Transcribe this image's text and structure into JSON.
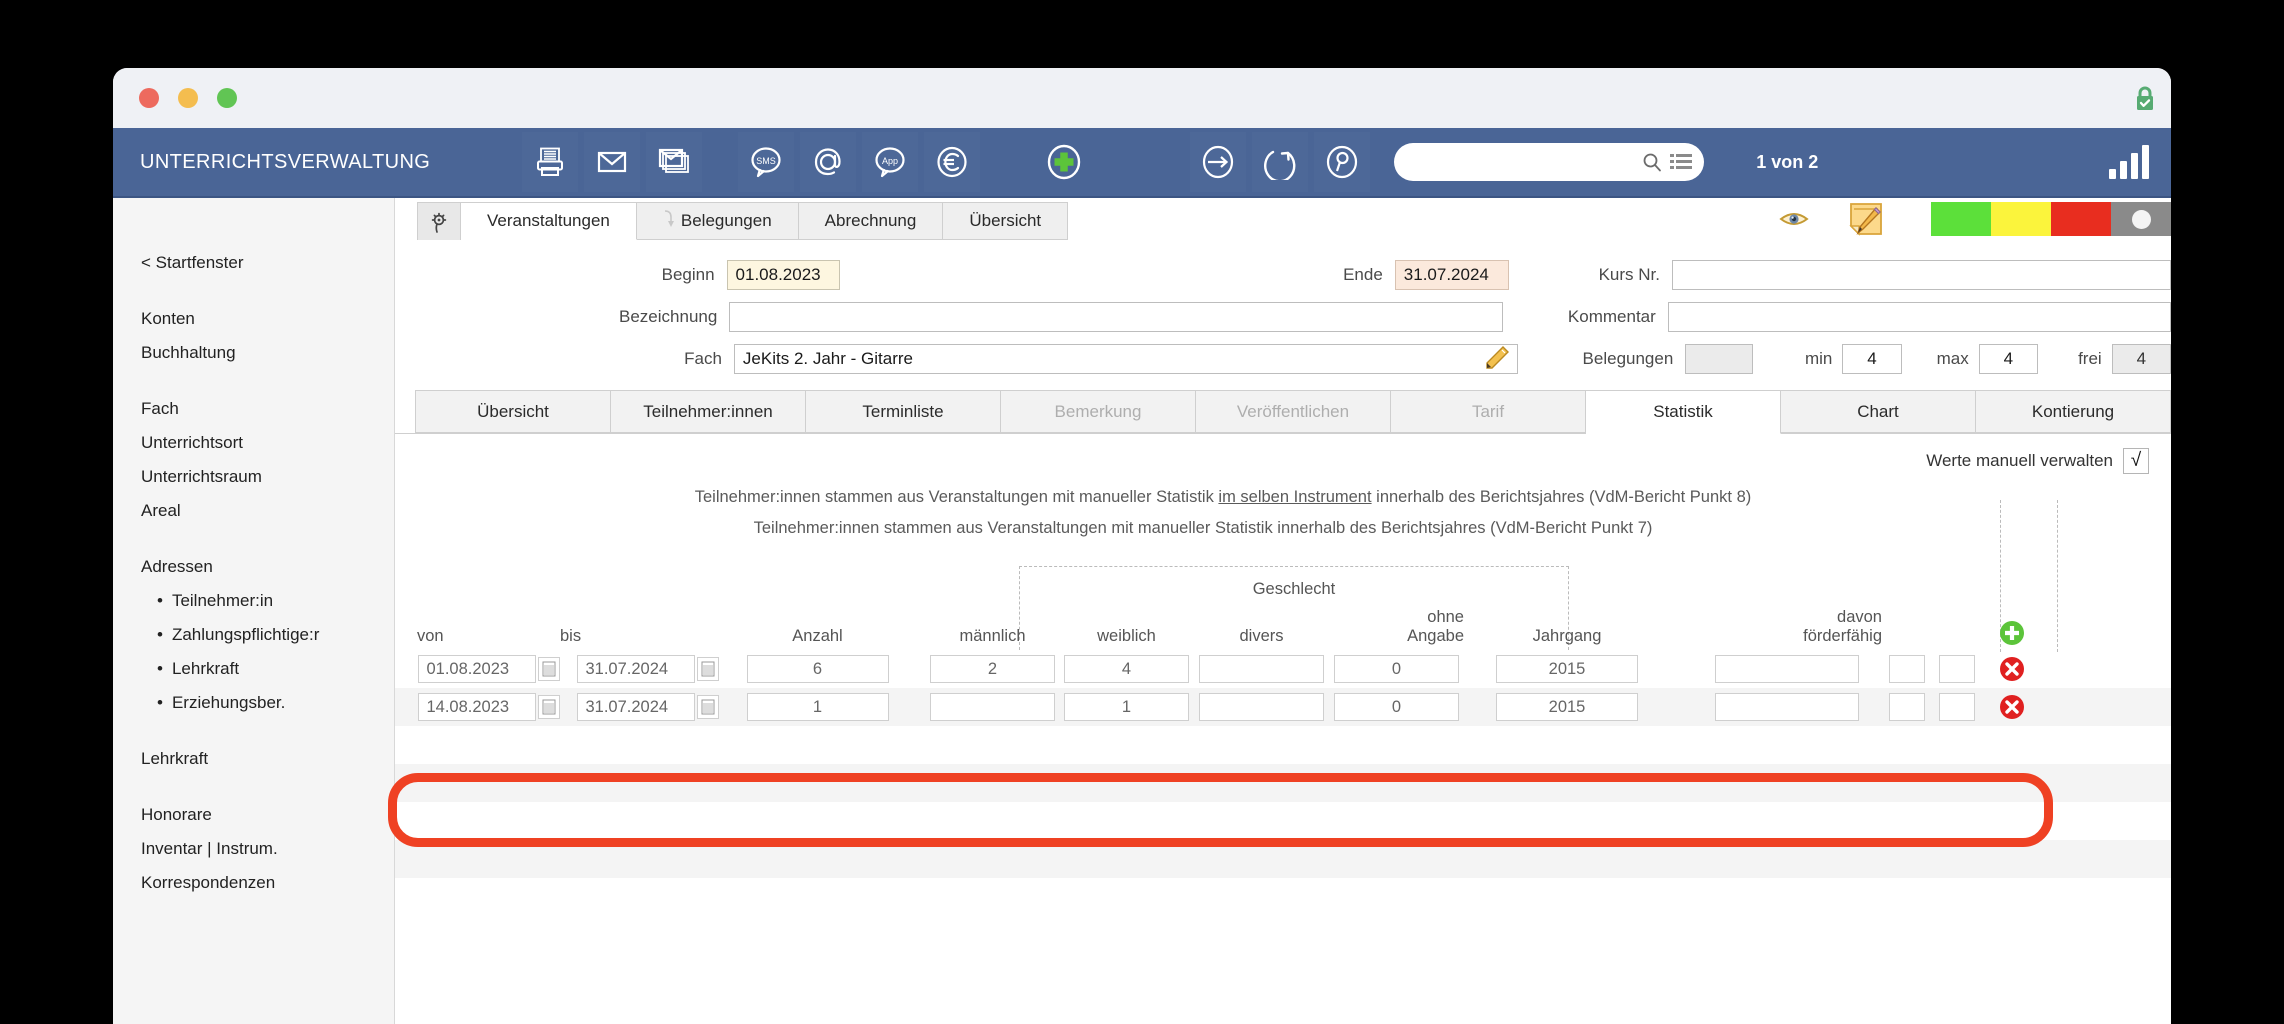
{
  "window": {
    "title": "UNTERRICHTSVERWALTUNG",
    "lock_icon": "lock-secure-icon"
  },
  "toolbar": {
    "icons": [
      {
        "name": "printer-icon",
        "label": "Drucken"
      },
      {
        "name": "mail-icon",
        "label": "E-Mail"
      },
      {
        "name": "mail-stack-icon",
        "label": "Serienmail"
      },
      {
        "name": "sms-bubble-icon",
        "label": "SMS"
      },
      {
        "name": "at-sign-icon",
        "label": "E-Mail Adresse"
      },
      {
        "name": "app-bubble-icon",
        "label": "App"
      },
      {
        "name": "euro-icon",
        "label": "Euro"
      },
      {
        "name": "plus-circle-icon",
        "label": "Neu"
      },
      {
        "name": "arrow-right-circle-icon",
        "label": "Gehe zu"
      },
      {
        "name": "refresh-circle-icon",
        "label": "Aktualisieren"
      },
      {
        "name": "search-circle-icon",
        "label": "Suchen"
      }
    ],
    "search_value": "",
    "search_placeholder": "",
    "search_icon": "magnifier-icon",
    "list_icon": "list-icon",
    "page_count": "1 von 2",
    "chart_icon": "bar-chart-icon"
  },
  "sidebar": {
    "back_label": "< Startfenster",
    "groups": [
      {
        "items": [
          "Konten",
          "Buchhaltung"
        ]
      },
      {
        "items": [
          "Fach",
          "Unterrichtsort",
          "Unterrichtsraum",
          "Areal"
        ]
      },
      {
        "items": [
          "Adressen"
        ],
        "subitems": [
          "Teilnehmer:in",
          "Zahlungspflichtige:r",
          "Lehrkraft",
          "Erziehungsber."
        ]
      },
      {
        "items": [
          "Lehrkraft"
        ]
      },
      {
        "items": [
          "Honorare",
          "Inventar | Instrum.",
          "Korrespondenzen"
        ]
      }
    ]
  },
  "top_tabs": {
    "gear_icon": "gear-icon",
    "items": [
      {
        "label": "Veranstaltungen",
        "active": true,
        "icon": null
      },
      {
        "label": "Belegungen",
        "active": false,
        "icon": "hook-icon"
      },
      {
        "label": "Abrechnung",
        "active": false,
        "icon": null
      },
      {
        "label": "Übersicht",
        "active": false,
        "icon": null
      }
    ],
    "eye_icon": "eye-icon",
    "note_edit_icon": "note-edit-icon",
    "swatches": [
      "#5ce03a",
      "#fbf43c",
      "#e82d1f",
      "#8a8a8a"
    ]
  },
  "form": {
    "beginn_label": "Beginn",
    "beginn_value": "01.08.2023",
    "ende_label": "Ende",
    "ende_value": "31.07.2024",
    "bezeichnung_label": "Bezeichnung",
    "bezeichnung_value": "",
    "fach_label": "Fach",
    "fach_value": "JeKits 2. Jahr - Gitarre",
    "fach_edit_icon": "pencil-icon",
    "kursnr_label": "Kurs Nr.",
    "kursnr_value": "",
    "kommentar_label": "Kommentar",
    "kommentar_value": "",
    "belegungen_label": "Belegungen",
    "belegungen_value": "",
    "min_label": "min",
    "min_value": "4",
    "max_label": "max",
    "max_value": "4",
    "frei_label": "frei",
    "frei_value": "4"
  },
  "sub_tabs": [
    {
      "label": "Übersicht",
      "state": "normal"
    },
    {
      "label": "Teilnehmer:innen",
      "state": "normal"
    },
    {
      "label": "Terminliste",
      "state": "normal"
    },
    {
      "label": "Bemerkung",
      "state": "disabled"
    },
    {
      "label": "Veröffentlichen",
      "state": "disabled"
    },
    {
      "label": "Tarif",
      "state": "disabled"
    },
    {
      "label": "Statistik",
      "state": "active"
    },
    {
      "label": "Chart",
      "state": "normal"
    },
    {
      "label": "Kontierung",
      "state": "normal"
    }
  ],
  "statistik": {
    "manual_label": "Werte manuell verwalten",
    "manual_checked": "√",
    "note_1_pre": "Teilnehmer:innen stammen aus Veranstaltungen mit manueller Statistik ",
    "note_1_underline": "im selben Instrument",
    "note_1_post": " innerhalb des Berichtsjahres (VdM-Bericht Punkt 8)",
    "note_2": "Teilnehmer:innen stammen aus Veranstaltungen mit manueller Statistik innerhalb des Berichtsjahres (VdM-Bericht Punkt 7)",
    "group_header": "Geschlecht",
    "add_icon": "add-row-icon",
    "delete_icon": "delete-row-icon",
    "calendar_icon": "calendar-icon",
    "columns": [
      "von",
      "bis",
      "Anzahl",
      "männlich",
      "weiblich",
      "divers",
      "ohne\nAngabe",
      "Jahrgang",
      "davon\nförderfähig"
    ],
    "columns_display": {
      "von": "von",
      "bis": "bis",
      "anzahl": "Anzahl",
      "maennlich": "männlich",
      "weiblich": "weiblich",
      "divers": "divers",
      "ohne_angabe_l1": "ohne",
      "ohne_angabe_l2": "Angabe",
      "jahrgang": "Jahrgang",
      "foerder_l1": "davon",
      "foerder_l2": "förderfähig"
    },
    "rows": [
      {
        "von": "01.08.2023",
        "bis": "31.07.2024",
        "anzahl": "6",
        "maennlich": "2",
        "weiblich": "4",
        "divers": "",
        "ohne_angabe": "0",
        "jahrgang": "2015",
        "foerderfaehig": "",
        "extra1": "",
        "extra2": ""
      },
      {
        "von": "14.08.2023",
        "bis": "31.07.2024",
        "anzahl": "1",
        "maennlich": "",
        "weiblich": "1",
        "divers": "",
        "ohne_angabe": "0",
        "jahrgang": "2015",
        "foerderfaehig": "",
        "extra1": "",
        "extra2": ""
      }
    ],
    "empty_rows": 4
  },
  "annotation": {
    "highlight_color": "#ef4123",
    "shape": "rounded-rectangle"
  }
}
